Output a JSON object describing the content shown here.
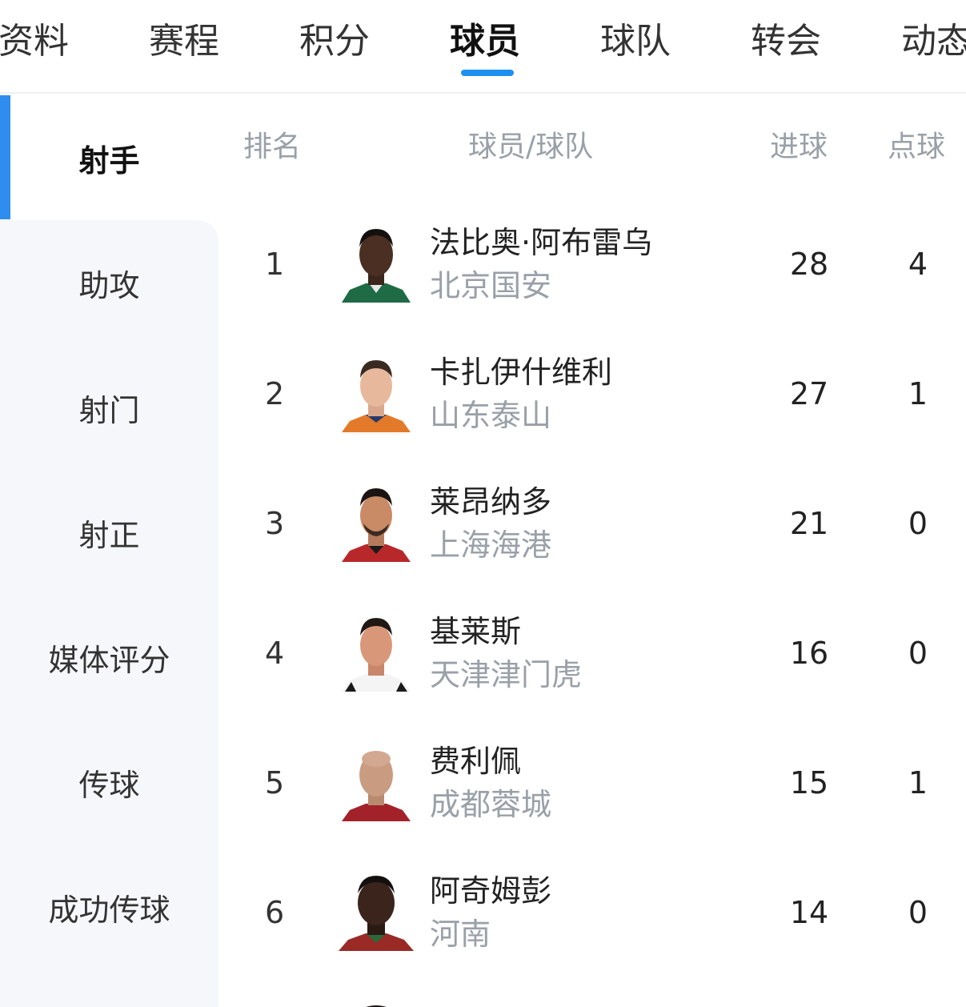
{
  "tabs": [
    {
      "label": "资料"
    },
    {
      "label": "赛程"
    },
    {
      "label": "积分"
    },
    {
      "label": "球员"
    },
    {
      "label": "球队"
    },
    {
      "label": "转会"
    },
    {
      "label": "动态"
    }
  ],
  "active_tab": "球员",
  "sidebar": {
    "items": [
      {
        "label": "射手"
      },
      {
        "label": "助攻"
      },
      {
        "label": "射门"
      },
      {
        "label": "射正"
      },
      {
        "label": "媒体评分"
      },
      {
        "label": "传球"
      },
      {
        "label": "成功传球"
      }
    ],
    "active": "射手"
  },
  "table": {
    "headers": {
      "rank": "排名",
      "player_team": "球员/球队",
      "goals": "进球",
      "penalties": "点球"
    },
    "rows": [
      {
        "rank": "1",
        "name": "法比奥·阿布雷乌",
        "team": "北京国安",
        "goals": "28",
        "penalties": "4"
      },
      {
        "rank": "2",
        "name": "卡扎伊什维利",
        "team": "山东泰山",
        "goals": "27",
        "penalties": "1"
      },
      {
        "rank": "3",
        "name": "莱昂纳多",
        "team": "上海海港",
        "goals": "21",
        "penalties": "0"
      },
      {
        "rank": "4",
        "name": "基莱斯",
        "team": "天津津门虎",
        "goals": "16",
        "penalties": "0"
      },
      {
        "rank": "5",
        "name": "费利佩",
        "team": "成都蓉城",
        "goals": "15",
        "penalties": "1"
      },
      {
        "rank": "6",
        "name": "阿奇姆彭",
        "team": "河南",
        "goals": "14",
        "penalties": "0"
      }
    ]
  },
  "colors": {
    "accent": "#1e90f0",
    "sidebar_bg": "#f5f7fa",
    "muted_text": "#9aa0a8"
  }
}
